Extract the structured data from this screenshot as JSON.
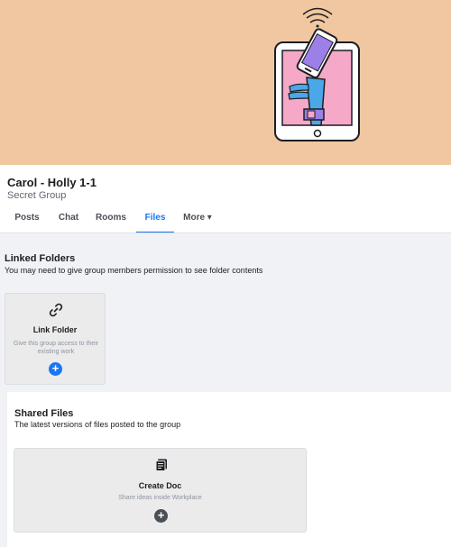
{
  "group": {
    "name": "Carol - Holly 1-1",
    "privacy": "Secret Group"
  },
  "tabs": [
    {
      "label": "Posts",
      "active": false
    },
    {
      "label": "Chat",
      "active": false
    },
    {
      "label": "Rooms",
      "active": false
    },
    {
      "label": "Files",
      "active": true
    },
    {
      "label": "More ▾",
      "active": false
    }
  ],
  "linked_folders": {
    "title": "Linked Folders",
    "description": "You may need to give group members permission to see folder contents",
    "card": {
      "icon": "link-icon",
      "title": "Link Folder",
      "description": "Give this group access to their existing work",
      "action_icon": "plus-icon"
    }
  },
  "shared_files": {
    "title": "Shared Files",
    "description": "The latest versions of files posted to the group",
    "card": {
      "icon": "document-icon",
      "title": "Create Doc",
      "description": "Share ideas inside Workplace",
      "action_icon": "plus-icon"
    }
  },
  "colors": {
    "cover_bg": "#f0c7a0",
    "accent": "#1877f2",
    "tablet_screen": "#f5a8c8",
    "phone": "#9d7fe8",
    "arm": "#4aa8e8"
  }
}
